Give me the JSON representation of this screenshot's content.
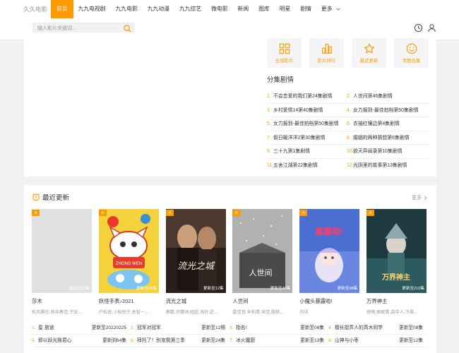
{
  "header": {
    "logo": "久久电影",
    "nav": [
      "首页",
      "九九电视剧",
      "九九电影",
      "九九动漫",
      "九九综艺",
      "微电影",
      "新闻",
      "图库",
      "明星",
      "剧情"
    ],
    "more": "更多",
    "search_placeholder": "输入影片关键词..."
  },
  "quick_links": [
    "全部影片",
    "影片排行",
    "最近更新",
    "专题合集"
  ],
  "episodes": {
    "title": "分集剧情",
    "items": [
      {
        "num": "1.",
        "text": "不会恋爱的我们第24集剧情"
      },
      {
        "num": "2.",
        "text": "人世间第46集剧情"
      },
      {
        "num": "3.",
        "text": "乡村爱情14第40集剧情"
      },
      {
        "num": "4.",
        "text": "女力报到-最佳拍档第50集剧情"
      },
      {
        "num": "5.",
        "text": "女力报到-最佳拍档第50集剧情"
      },
      {
        "num": "6.",
        "text": "衣袖红镶边第4集剧情"
      },
      {
        "num": "7.",
        "text": "假日暖洋洋2第30集剧情"
      },
      {
        "num": "8.",
        "text": "婚姻的两种猜想第6集剧情"
      },
      {
        "num": "9.",
        "text": "三十九第1集剧情"
      },
      {
        "num": "10.",
        "text": "欲天异闻录第10集剧情"
      },
      {
        "num": "11.",
        "text": "五舍江湖第22集剧情"
      },
      {
        "num": "12.",
        "text": "光阴里的故事第13集剧情"
      }
    ]
  },
  "latest": {
    "title": "最近更新",
    "more": "更多",
    "posters": [
      {
        "badge": "大",
        "status": "更新至22集",
        "title": "莎木",
        "actors": "松风雅也,熊井春佳,子安..."
      },
      {
        "badge": "大",
        "status": "更新至20集",
        "title": "妖怪手表♪2021",
        "actors": "户松遥,小桜悦子,关智一,..."
      },
      {
        "badge": "大",
        "status": "更新至12集",
        "title": "流光之城",
        "actors": "蔡懿,许魏洲,经超,海铃,近..."
      },
      {
        "badge": "大",
        "status": "更新至46集",
        "title": "人世间",
        "actors": "雷佳音,辛柏青,宋佳,殷桃,..."
      },
      {
        "badge": "大",
        "status": "更新至08集",
        "title": "小魔头暴露啦!",
        "actors": "内详"
      },
      {
        "badge": "大",
        "status": "更新至210集",
        "title": "万界神主",
        "actors": "徐翔,柳妮熏,森中人,冷晨..."
      }
    ],
    "poster_art": {
      "p1": "ZHONG WEN",
      "p3": "流光之城",
      "p4": "人世间",
      "p5": "暴露啦!",
      "p6": "万界神主"
    },
    "list": [
      {
        "num": "1.",
        "title": "星·旅途",
        "status": "更新至20220225"
      },
      {
        "num": "2.",
        "title": "冠军对冠军",
        "status": "更新至12期"
      },
      {
        "num": "3.",
        "title": "指名!",
        "status": "更新至08集"
      },
      {
        "num": "4.",
        "title": "擅长捉弄人的高木同学",
        "status": "更新至08集"
      },
      {
        "num": "5.",
        "title": "即以跃光挽君心",
        "status": "更新到64集"
      },
      {
        "num": "6.",
        "title": "拜托了！别宠我第三季",
        "status": "更新至24集"
      },
      {
        "num": "7.",
        "title": "冰火魔厨",
        "status": "更新至13集"
      },
      {
        "num": "8.",
        "title": "山神与小枣",
        "status": "更新至12集"
      }
    ]
  },
  "colors": {
    "accent": "#ff9900"
  }
}
